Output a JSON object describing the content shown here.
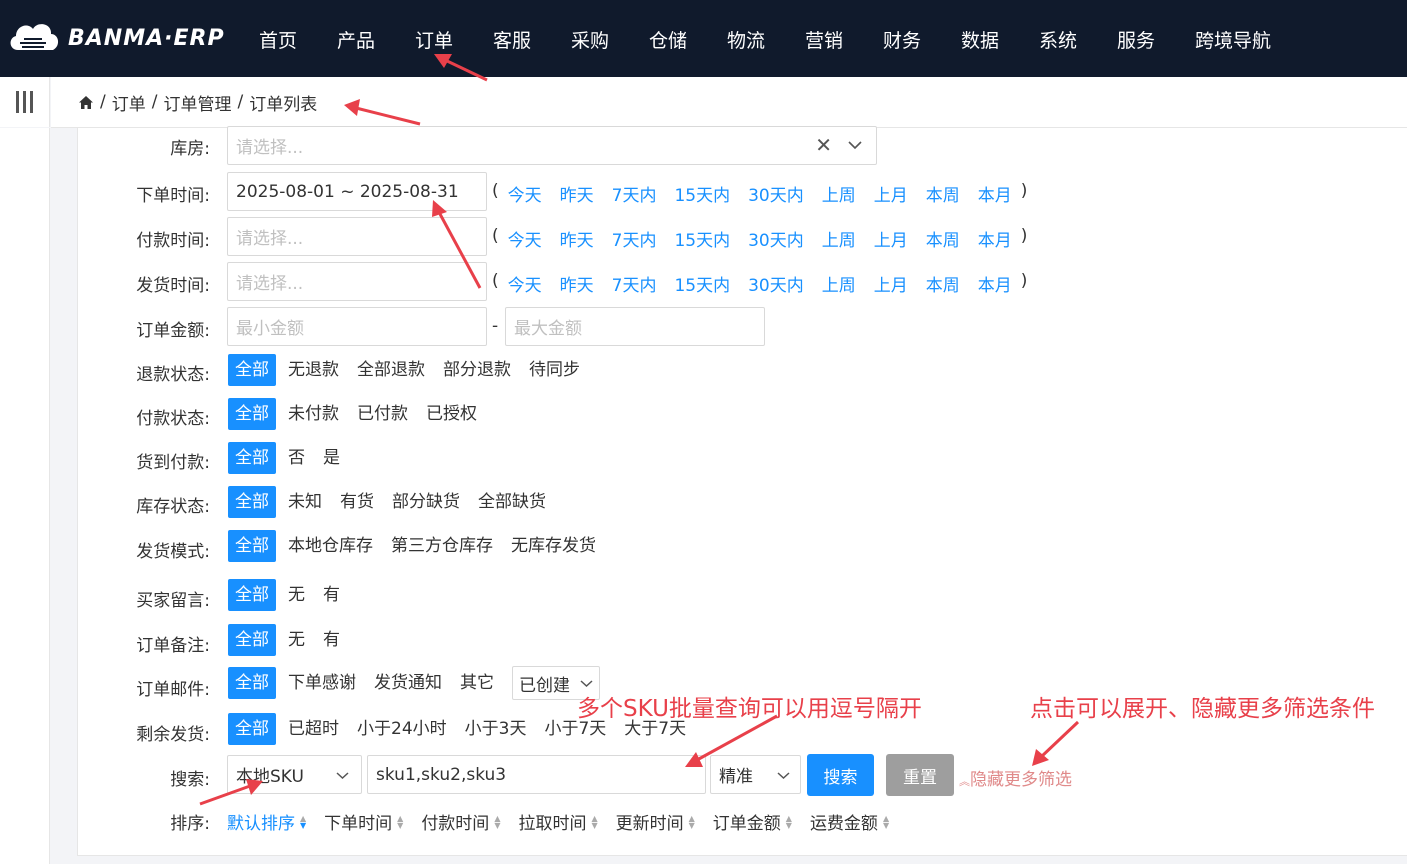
{
  "header": {
    "logo_text": "BANMA·ERP",
    "nav": [
      "首页",
      "产品",
      "订单",
      "客服",
      "采购",
      "仓储",
      "物流",
      "营销",
      "财务",
      "数据",
      "系统",
      "服务",
      "跨境导航"
    ]
  },
  "breadcrumb": [
    "订单",
    "订单管理",
    "订单列表"
  ],
  "filters": {
    "warehouse_label": "库房:",
    "warehouse_placeholder": "请选择...",
    "order_time_label": "下单时间:",
    "order_time_value": "2025-08-01 ~ 2025-08-31",
    "pay_time_label": "付款时间:",
    "pay_time_placeholder": "请选择...",
    "ship_time_label": "发货时间:",
    "ship_time_placeholder": "请选择...",
    "quick_dates": [
      "今天",
      "昨天",
      "7天内",
      "15天内",
      "30天内",
      "上周",
      "上月",
      "本周",
      "本月"
    ],
    "amount_label": "订单金额:",
    "amount_min_placeholder": "最小金额",
    "amount_max_placeholder": "最大金额",
    "amount_sep": "-",
    "refund_label": "退款状态:",
    "refund_options": [
      "全部",
      "无退款",
      "全部退款",
      "部分退款",
      "待同步"
    ],
    "pay_status_label": "付款状态:",
    "pay_status_options": [
      "全部",
      "未付款",
      "已付款",
      "已授权"
    ],
    "cod_label": "货到付款:",
    "cod_options": [
      "全部",
      "否",
      "是"
    ],
    "stock_label": "库存状态:",
    "stock_options": [
      "全部",
      "未知",
      "有货",
      "部分缺货",
      "全部缺货"
    ],
    "ship_mode_label": "发货模式:",
    "ship_mode_options": [
      "全部",
      "本地仓库存",
      "第三方仓库存",
      "无库存发货"
    ],
    "buyer_msg_label": "买家留言:",
    "buyer_msg_options": [
      "全部",
      "无",
      "有"
    ],
    "order_note_label": "订单备注:",
    "order_note_options": [
      "全部",
      "无",
      "有"
    ],
    "order_mail_label": "订单邮件:",
    "order_mail_options": [
      "全部",
      "下单感谢",
      "发货通知",
      "其它"
    ],
    "order_mail_select": "已创建",
    "remaining_label": "剩余发货:",
    "remaining_options": [
      "全部",
      "已超时",
      "小于24小时",
      "小于3天",
      "小于7天",
      "大于7天"
    ],
    "search_label": "搜索:",
    "search_field": "本地SKU",
    "search_value": "sku1,sku2,sku3",
    "match_mode": "精准",
    "search_btn": "搜索",
    "reset_btn": "重置",
    "toggle_more": "隐藏更多筛选",
    "sort_label": "排序:",
    "sort_options": [
      "默认排序",
      "下单时间",
      "付款时间",
      "拉取时间",
      "更新时间",
      "订单金额",
      "运费金额"
    ]
  },
  "annotations": {
    "sku_hint": "多个SKU批量查询可以用逗号隔开",
    "toggle_hint": "点击可以展开、隐藏更多筛选条件"
  },
  "colors": {
    "topbar": "#101a2c",
    "accent": "#1890ff",
    "annotation": "#e8404a",
    "reset": "#9e9e9e"
  }
}
